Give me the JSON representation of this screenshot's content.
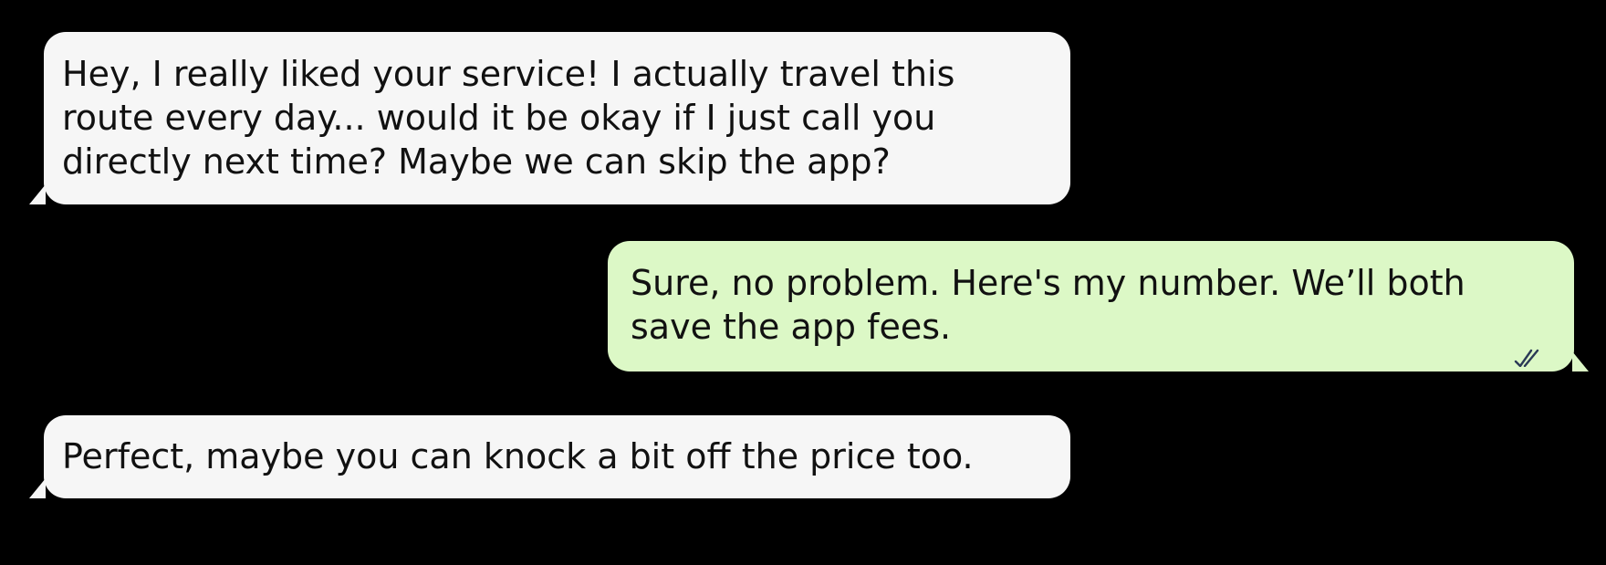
{
  "chat": {
    "messages": [
      {
        "direction": "incoming",
        "text": "Hey, I really liked your service! I actually travel this route every day... would it be okay if I just call you directly next time? Maybe we can skip the app?"
      },
      {
        "direction": "outgoing",
        "text": "Sure, no problem. Here's my number. We’ll both save the app fees.",
        "status_icon": "double-check-icon"
      },
      {
        "direction": "incoming",
        "text": "Perfect, maybe you can knock a bit off the price too."
      }
    ]
  },
  "colors": {
    "background": "#000000",
    "incoming_bubble": "#f6f6f6",
    "outgoing_bubble": "#dcf8c6",
    "text": "#111111",
    "read_ticks": "#2a3a56"
  }
}
